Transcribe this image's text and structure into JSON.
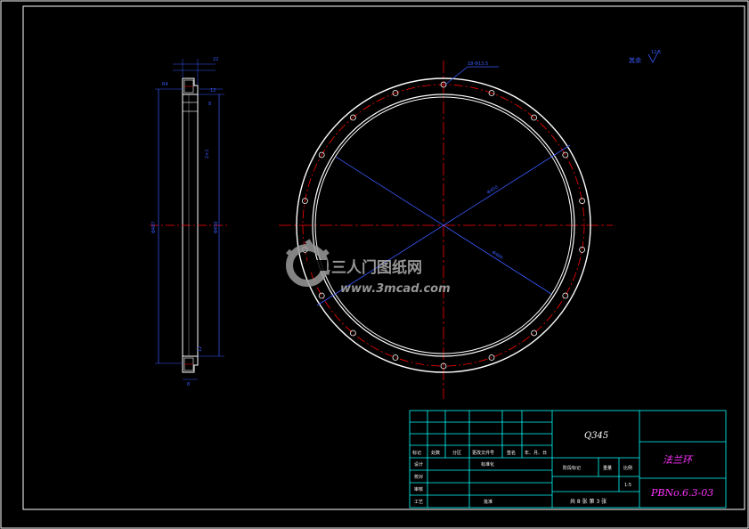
{
  "colors": {
    "background": "#000000",
    "frame": "#ffffff",
    "outline": "#ffffff",
    "center_line": "#ff0000",
    "dimension": "#3a5bff",
    "title_block": "#00ffff",
    "title_text": "#ff33ff",
    "watermark": "#9a9a9a"
  },
  "drawing": {
    "hole_note": "18-Φ13.5",
    "roughness_note": "其余",
    "roughness_value": "12.5",
    "inner_diameter": "Φ450",
    "outer_diameter": "Φ486",
    "side_dims": {
      "top_width": "22",
      "flange_width": "R4",
      "step": "12",
      "small": "8",
      "bore_vertical": "Φ487",
      "shaft_vertical": "Φ450",
      "mid": "2×1"
    }
  },
  "watermark": {
    "name": "三人门图纸网",
    "url": "www.3mcad.com"
  },
  "title_block": {
    "material": "Q345",
    "part_name": "法兰环",
    "drawing_no": "PBNo.6.3-03",
    "sheet_info": "共 8 张  第 3 张",
    "row_labels": [
      "标记",
      "处数",
      "分区",
      "更改文件号",
      "签名",
      "年、月、日"
    ],
    "side_labels": [
      "设计",
      "校对",
      "审核",
      "工艺"
    ],
    "std_label": "标准化",
    "approve_label": "批准",
    "stage_labels": [
      "阶段标记",
      "重量",
      "比例"
    ],
    "scale": "1:5"
  }
}
